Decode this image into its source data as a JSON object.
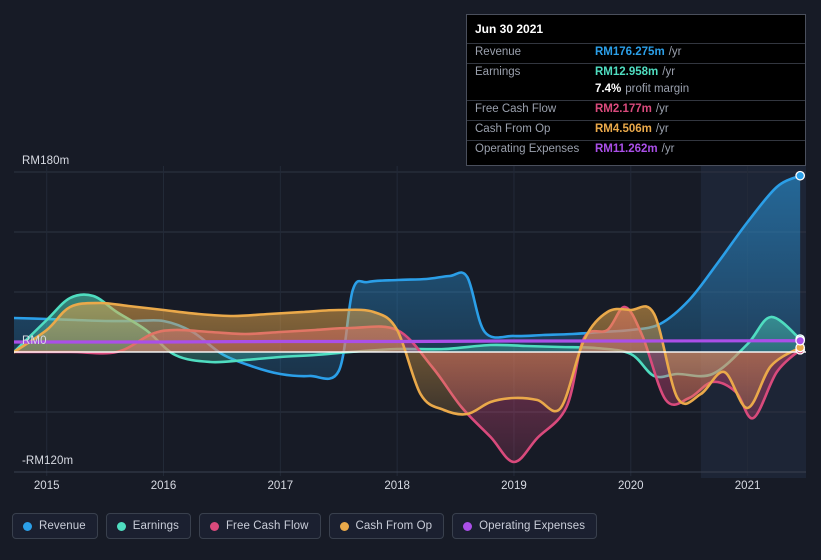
{
  "colors": {
    "background": "#171b26",
    "revenue": "#2b9fe8",
    "earnings": "#4fddc0",
    "free_cash_flow": "#d94a7c",
    "cash_from_op": "#eaa94a",
    "operating_expenses": "#aa4fe8",
    "zero_line": "#ffffff",
    "grid": "#2e3442",
    "axis_text": "#d7dae2"
  },
  "tooltip": {
    "date": "Jun 30 2021",
    "rows": [
      {
        "key": "Revenue",
        "value": "RM176.275m",
        "unit": "/yr",
        "color": "#2b9fe8"
      },
      {
        "key": "Earnings",
        "value": "RM12.958m",
        "unit": "/yr",
        "color": "#4fddc0"
      },
      {
        "key": "",
        "value": "7.4%",
        "unit": "profit margin",
        "color": "#ffffff",
        "sub": true
      },
      {
        "key": "Free Cash Flow",
        "value": "RM2.177m",
        "unit": "/yr",
        "color": "#d94a7c"
      },
      {
        "key": "Cash From Op",
        "value": "RM4.506m",
        "unit": "/yr",
        "color": "#eaa94a"
      },
      {
        "key": "Operating Expenses",
        "value": "RM11.262m",
        "unit": "/yr",
        "color": "#aa4fe8"
      }
    ]
  },
  "legend": {
    "items": [
      {
        "label": "Revenue",
        "color": "#2b9fe8"
      },
      {
        "label": "Earnings",
        "color": "#4fddc0"
      },
      {
        "label": "Free Cash Flow",
        "color": "#d94a7c"
      },
      {
        "label": "Cash From Op",
        "color": "#eaa94a"
      },
      {
        "label": "Operating Expenses",
        "color": "#aa4fe8"
      }
    ]
  },
  "chart_data": {
    "type": "area",
    "title": "",
    "xlabel": "",
    "ylabel": "",
    "currency": "RM",
    "unit": "m",
    "ylim": [
      -120,
      180
    ],
    "y_ticks": [
      {
        "value": 180,
        "label": "RM180m"
      },
      {
        "value": 0,
        "label": "RM0"
      },
      {
        "value": -120,
        "label": "-RM120m"
      }
    ],
    "grid": true,
    "gridlines_y": [
      180,
      120,
      60,
      -60
    ],
    "x_ticks": [
      "2015",
      "2016",
      "2017",
      "2018",
      "2019",
      "2020",
      "2021"
    ],
    "xlim": [
      2014.72,
      2021.5
    ],
    "forecast_start": "2020.6",
    "legend_position": "bottom",
    "series": [
      {
        "name": "Revenue",
        "color": "#2b9fe8",
        "x": [
          2014.72,
          2015.0,
          2015.25,
          2015.5,
          2015.75,
          2016.0,
          2016.25,
          2016.5,
          2016.75,
          2017.0,
          2017.25,
          2017.5,
          2017.62,
          2017.75,
          2018.0,
          2018.25,
          2018.45,
          2018.6,
          2018.75,
          2019.0,
          2019.25,
          2019.5,
          2019.75,
          2020.0,
          2020.25,
          2020.5,
          2020.75,
          2021.0,
          2021.25,
          2021.45
        ],
        "values": [
          34,
          33,
          32,
          31,
          31,
          31,
          20,
          -2,
          -14,
          -22,
          -24,
          -19,
          62,
          70,
          72,
          73,
          76,
          75,
          20,
          16,
          17,
          18,
          20,
          22,
          28,
          52,
          90,
          130,
          165,
          176.275
        ]
      },
      {
        "name": "Earnings",
        "color": "#4fddc0",
        "x": [
          2014.72,
          2015.0,
          2015.2,
          2015.4,
          2015.6,
          2015.85,
          2016.1,
          2016.4,
          2016.7,
          2017.0,
          2017.3,
          2017.6,
          2018.0,
          2018.4,
          2018.8,
          2019.1,
          2019.4,
          2019.7,
          2020.0,
          2020.2,
          2020.4,
          2020.7,
          2021.0,
          2021.2,
          2021.45
        ],
        "values": [
          0,
          32,
          54,
          56,
          40,
          22,
          -3,
          -10,
          -8,
          -5,
          -3,
          0,
          3,
          3,
          7,
          6,
          5,
          4,
          -2,
          -24,
          -22,
          -22,
          8,
          35,
          12.958
        ]
      },
      {
        "name": "Free Cash Flow",
        "color": "#d94a7c",
        "x": [
          2014.72,
          2015.2,
          2015.6,
          2015.9,
          2016.1,
          2016.4,
          2016.7,
          2017.0,
          2017.3,
          2017.6,
          2018.0,
          2018.3,
          2018.55,
          2018.8,
          2019.0,
          2019.2,
          2019.45,
          2019.6,
          2019.8,
          2019.95,
          2020.1,
          2020.3,
          2020.5,
          2020.7,
          2020.9,
          2021.05,
          2021.25,
          2021.45
        ],
        "values": [
          0,
          0,
          0,
          18,
          22,
          20,
          18,
          20,
          22,
          24,
          22,
          -15,
          -55,
          -85,
          -110,
          -86,
          -55,
          14,
          22,
          45,
          16,
          -48,
          -46,
          -30,
          -40,
          -66,
          -20,
          2.177
        ]
      },
      {
        "name": "Cash From Op",
        "color": "#eaa94a",
        "x": [
          2014.72,
          2015.0,
          2015.2,
          2015.45,
          2015.7,
          2016.0,
          2016.3,
          2016.6,
          2016.9,
          2017.2,
          2017.5,
          2017.8,
          2018.0,
          2018.2,
          2018.4,
          2018.6,
          2018.8,
          2019.0,
          2019.2,
          2019.4,
          2019.6,
          2019.8,
          2020.0,
          2020.2,
          2020.4,
          2020.6,
          2020.8,
          2021.0,
          2021.2,
          2021.45
        ],
        "values": [
          0,
          22,
          45,
          49,
          46,
          42,
          38,
          36,
          38,
          40,
          42,
          40,
          22,
          -42,
          -58,
          -62,
          -50,
          -46,
          -48,
          -56,
          12,
          40,
          42,
          38,
          -46,
          -42,
          -20,
          -56,
          -14,
          4.506
        ]
      },
      {
        "name": "Operating Expenses",
        "color": "#aa4fe8",
        "x": [
          2014.72,
          2016.0,
          2017.0,
          2018.0,
          2019.0,
          2020.0,
          2021.0,
          2021.45
        ],
        "values": [
          10,
          10,
          10.5,
          10.5,
          11,
          11,
          11.2,
          11.262
        ]
      }
    ]
  }
}
